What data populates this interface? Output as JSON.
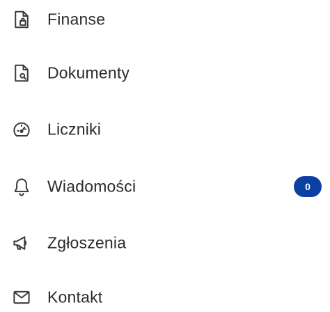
{
  "menu": {
    "items": [
      {
        "label": "Finanse",
        "icon": "finance-document-icon"
      },
      {
        "label": "Dokumenty",
        "icon": "document-search-icon"
      },
      {
        "label": "Liczniki",
        "icon": "meter-gauge-icon"
      },
      {
        "label": "Wiadomości",
        "icon": "bell-icon",
        "badge": "0"
      },
      {
        "label": "Zgłoszenia",
        "icon": "megaphone-icon"
      },
      {
        "label": "Kontakt",
        "icon": "envelope-icon"
      }
    ]
  },
  "colors": {
    "badge_background": "#0a3fa3",
    "badge_text": "#ffffff",
    "label_text": "#2b2b2b",
    "icon_stroke": "#3a3a3a",
    "background": "#ffffff"
  }
}
